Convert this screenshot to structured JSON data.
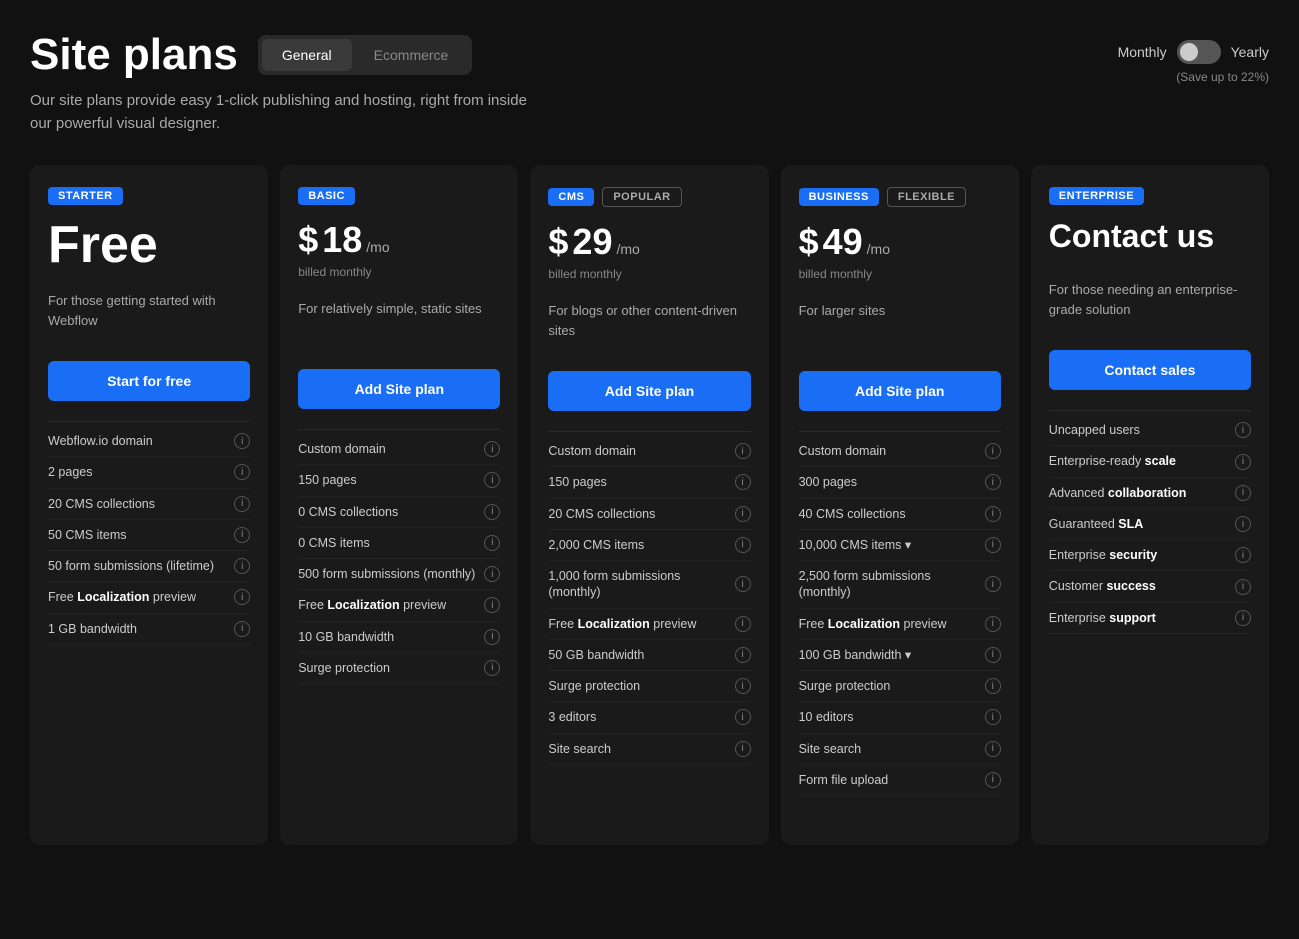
{
  "page": {
    "title": "Site plans",
    "subtitle": "Our site plans provide easy 1-click publishing and hosting, right from inside our powerful visual designer.",
    "tabs": [
      {
        "label": "General",
        "active": true
      },
      {
        "label": "Ecommerce",
        "active": false
      }
    ],
    "billing": {
      "monthly_label": "Monthly",
      "yearly_label": "Yearly",
      "save_text": "(Save up to 22%)"
    }
  },
  "plans": [
    {
      "id": "starter",
      "badge": "STARTER",
      "extra_badge": null,
      "price_type": "free",
      "price_display": "Free",
      "billed_text": null,
      "description": "For those getting started with Webflow",
      "cta": "Start for free",
      "features": [
        {
          "text": "Webflow.io domain",
          "bold": null
        },
        {
          "text": "2 pages",
          "bold": null
        },
        {
          "text": "20 CMS collections",
          "bold": null
        },
        {
          "text": "50 CMS items",
          "bold": null
        },
        {
          "text": "50 form submissions (lifetime)",
          "bold": null
        },
        {
          "text": "Free Localization preview",
          "bold": "Localization"
        },
        {
          "text": "1 GB bandwidth",
          "bold": null
        }
      ]
    },
    {
      "id": "basic",
      "badge": "BASIC",
      "extra_badge": null,
      "price_type": "paid",
      "price_dollar": "$",
      "price_amount": "18",
      "price_per": "/mo",
      "billed_text": "billed monthly",
      "description": "For relatively simple, static sites",
      "cta": "Add Site plan",
      "features": [
        {
          "text": "Custom domain",
          "bold": null
        },
        {
          "text": "150 pages",
          "bold": null
        },
        {
          "text": "0 CMS collections",
          "bold": null
        },
        {
          "text": "0 CMS items",
          "bold": null
        },
        {
          "text": "500 form submissions (monthly)",
          "bold": null
        },
        {
          "text": "Free Localization preview",
          "bold": "Localization"
        },
        {
          "text": "10 GB bandwidth",
          "bold": null
        },
        {
          "text": "Surge protection",
          "bold": null
        }
      ]
    },
    {
      "id": "cms",
      "badge": "CMS",
      "extra_badge": "POPULAR",
      "price_type": "paid",
      "price_dollar": "$",
      "price_amount": "29",
      "price_per": "/mo",
      "billed_text": "billed monthly",
      "description": "For blogs or other content-driven sites",
      "cta": "Add Site plan",
      "features": [
        {
          "text": "Custom domain",
          "bold": null
        },
        {
          "text": "150 pages",
          "bold": null
        },
        {
          "text": "20 CMS collections",
          "bold": null
        },
        {
          "text": "2,000 CMS items",
          "bold": null
        },
        {
          "text": "1,000 form submissions (monthly)",
          "bold": null
        },
        {
          "text": "Free Localization preview",
          "bold": "Localization"
        },
        {
          "text": "50 GB bandwidth",
          "bold": null
        },
        {
          "text": "Surge protection",
          "bold": null
        },
        {
          "text": "3 editors",
          "bold": null
        },
        {
          "text": "Site search",
          "bold": null
        }
      ]
    },
    {
      "id": "business",
      "badge": "BUSINESS",
      "extra_badge": "FLEXIBLE",
      "price_type": "paid",
      "price_dollar": "$",
      "price_amount": "49",
      "price_per": "/mo",
      "billed_text": "billed monthly",
      "description": "For larger sites",
      "cta": "Add Site plan",
      "features": [
        {
          "text": "Custom domain",
          "bold": null
        },
        {
          "text": "300 pages",
          "bold": null
        },
        {
          "text": "40 CMS collections",
          "bold": null
        },
        {
          "text": "10,000 CMS items",
          "bold": null,
          "dropdown": true
        },
        {
          "text": "2,500 form submissions (monthly)",
          "bold": null
        },
        {
          "text": "Free Localization preview",
          "bold": "Localization"
        },
        {
          "text": "100 GB bandwidth",
          "bold": null,
          "dropdown": true
        },
        {
          "text": "Surge protection",
          "bold": null
        },
        {
          "text": "10 editors",
          "bold": null
        },
        {
          "text": "Site search",
          "bold": null
        },
        {
          "text": "Form file upload",
          "bold": null
        }
      ]
    },
    {
      "id": "enterprise",
      "badge": "ENTERPRISE",
      "extra_badge": null,
      "price_type": "contact",
      "contact_title": "Contact us",
      "description": "For those needing an enterprise-grade solution",
      "cta": "Contact sales",
      "features": [
        {
          "text": "Uncapped users",
          "bold": null
        },
        {
          "text": "Enterprise-ready scale",
          "bold": "scale"
        },
        {
          "text": "Advanced collaboration",
          "bold": "collaboration"
        },
        {
          "text": "Guaranteed SLA",
          "bold": "SLA"
        },
        {
          "text": "Enterprise security",
          "bold": "security"
        },
        {
          "text": "Customer success",
          "bold": "success"
        },
        {
          "text": "Enterprise support",
          "bold": "support"
        }
      ]
    }
  ]
}
